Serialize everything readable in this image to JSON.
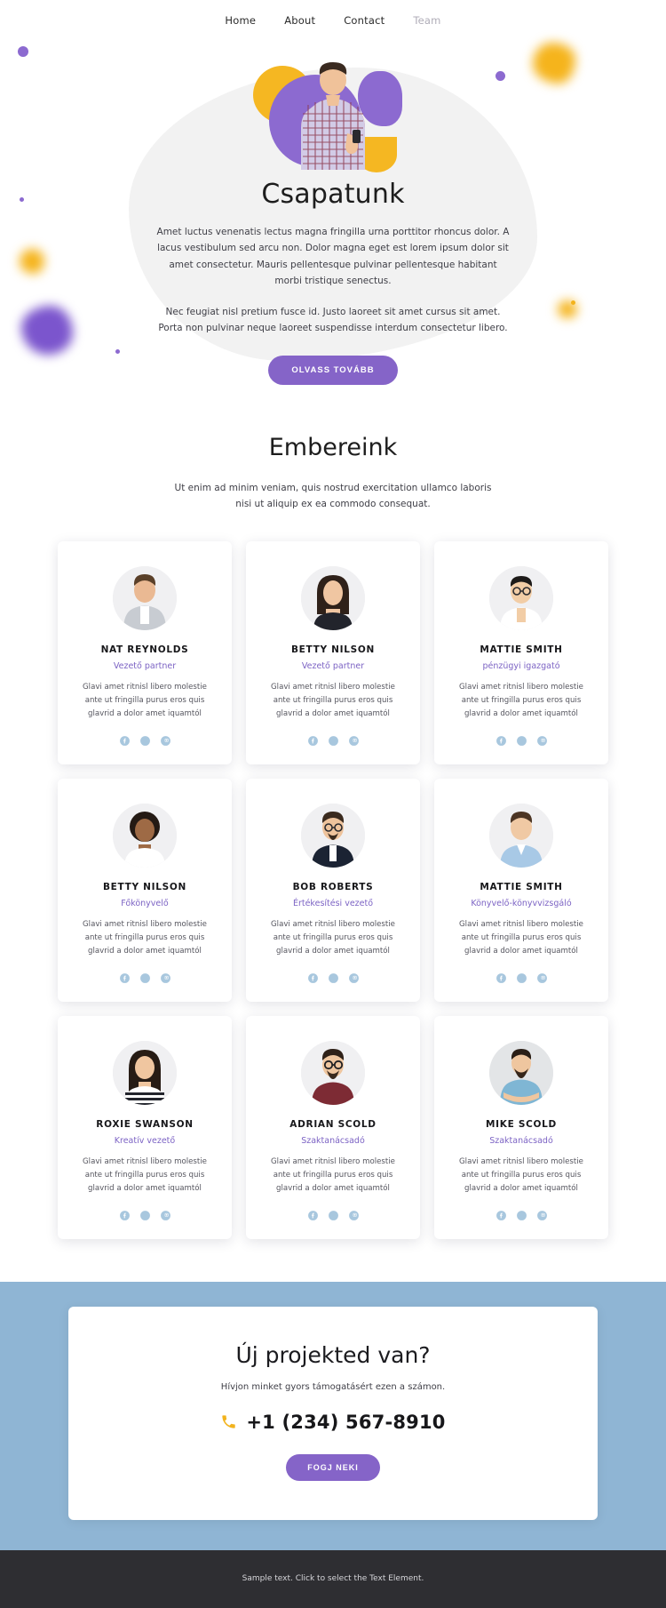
{
  "nav": {
    "items": [
      {
        "label": "Home",
        "active": false
      },
      {
        "label": "About",
        "active": false
      },
      {
        "label": "Contact",
        "active": false
      },
      {
        "label": "Team",
        "active": true
      }
    ]
  },
  "hero": {
    "title": "Csapatunk",
    "paragraph1": "Amet luctus venenatis lectus magna fringilla urna porttitor rhoncus dolor. A lacus vestibulum sed arcu non. Dolor magna eget est lorem ipsum dolor sit amet consectetur. Mauris pellentesque pulvinar pellentesque habitant morbi tristique senectus.",
    "paragraph2": "Nec feugiat nisl pretium fusce id. Justo laoreet sit amet cursus sit amet. Porta non pulvinar neque laoreet suspendisse interdum consectetur libero.",
    "button_label": "OLVASS TOVÁBB"
  },
  "people": {
    "title": "Embereink",
    "subtitle": "Ut enim ad minim veniam, quis nostrud exercitation ullamco laboris nisi ut aliquip ex ea commodo consequat.",
    "shared_description": "Glavi amet ritnisl libero molestie ante ut fringilla purus eros quis glavrid a dolor amet iquamtól",
    "members": [
      {
        "name": "NAT REYNOLDS",
        "role": "Vezető partner",
        "description": "Glavi amet ritnisl libero molestie ante ut fringilla purus eros quis glavrid a dolor amet iquamtól",
        "avatar": "man-beard-gray-jacket"
      },
      {
        "name": "BETTY NILSON",
        "role": "Vezető partner",
        "description": "Glavi amet ritnisl libero molestie ante ut fringilla purus eros quis glavrid a dolor amet iquamtól",
        "avatar": "woman-long-dark-hair"
      },
      {
        "name": "MATTIE SMITH",
        "role": "pénzügyi igazgató",
        "description": "Glavi amet ritnisl libero molestie ante ut fringilla purus eros quis glavrid a dolor amet iquamtól",
        "avatar": "man-glasses-white-shirt"
      },
      {
        "name": "BETTY NILSON",
        "role": "Főkönyvelő",
        "description": "Glavi amet ritnisl libero molestie ante ut fringilla purus eros quis glavrid a dolor amet iquamtól",
        "avatar": "woman-curly-hair"
      },
      {
        "name": "BOB ROBERTS",
        "role": "Értékesítési vezető",
        "description": "Glavi amet ritnisl libero molestie ante ut fringilla purus eros quis glavrid a dolor amet iquamtól",
        "avatar": "man-glasses-dark-suit"
      },
      {
        "name": "MATTIE SMITH",
        "role": "Könyvelő-könyvvizsgáló",
        "description": "Glavi amet ritnisl libero molestie ante ut fringilla purus eros quis glavrid a dolor amet iquamtól",
        "avatar": "man-light-blue-shirt"
      },
      {
        "name": "ROXIE SWANSON",
        "role": "Kreatív vezető",
        "description": "Glavi amet ritnisl libero molestie ante ut fringilla purus eros quis glavrid a dolor amet iquamtól",
        "avatar": "woman-striped-top"
      },
      {
        "name": "ADRIAN SCOLD",
        "role": "Szaktanácsadó",
        "description": "Glavi amet ritnisl libero molestie ante ut fringilla purus eros quis glavrid a dolor amet iquamtól",
        "avatar": "man-glasses-maroon-polo"
      },
      {
        "name": "MIKE SCOLD",
        "role": "Szaktanácsadó",
        "description": "Glavi amet ritnisl libero molestie ante ut fringilla purus eros quis glavrid a dolor amet iquamtól",
        "avatar": "man-beard-arms-crossed"
      }
    ],
    "social_icons": [
      "facebook-icon",
      "twitter-icon",
      "instagram-icon"
    ]
  },
  "cta": {
    "title": "Új projekted van?",
    "lead": "Hívjon minket gyors támogatásért ezen a számon.",
    "phone_icon": "phone-icon",
    "phone": "+1 (234) 567-8910",
    "button_label": "FOGJ NEKI"
  },
  "footer": {
    "text": "Sample text. Click to select the Text Element."
  },
  "colors": {
    "purple": "#8564c8",
    "yellow": "#f2b31d",
    "band_blue": "#8fb5d4",
    "social_blue": "#a8c7de",
    "footer_bg": "#2e2e32"
  }
}
